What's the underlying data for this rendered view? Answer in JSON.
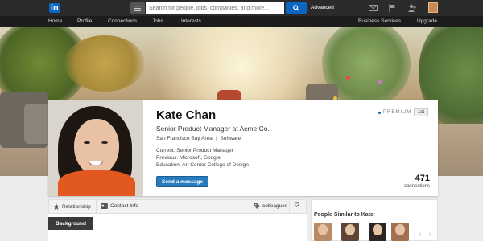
{
  "topbar": {
    "logo_text": "in",
    "search_placeholder": "Search for people, jobs, companies, and more...",
    "advanced_label": "Advanced",
    "icons": [
      "list-icon",
      "search-icon",
      "mail-icon",
      "flag-icon",
      "add-connection-icon",
      "profile-avatar"
    ]
  },
  "nav": {
    "items": [
      "Home",
      "Profile",
      "Connections",
      "Jobs",
      "Interests",
      "Business Services",
      "Upgrade"
    ]
  },
  "profile": {
    "name": "Kate Chan",
    "headline": "Senior Product Manager at Acme Co.",
    "location": "San Francisco Bay Area",
    "industry": "Software",
    "current": "Current: Senior Product Manager",
    "previous": "Previous: Microsoft, Google",
    "education": "Education: Art Center College of Design",
    "premium_label": "PREMIUM",
    "degree": "1st",
    "send_button": "Send a message",
    "connections_count": "471",
    "connections_label": "connections"
  },
  "tabs": {
    "relationship": "Relationship",
    "contact_info": "Contact Info",
    "tag": "colleagues"
  },
  "background_label": "Background",
  "similar": {
    "title": "People Similar to Kate"
  },
  "colors": {
    "topbar": "#2b2b2b",
    "navbar": "#1c1c1c",
    "accent": "#0a66c2",
    "send_button": "#287bbc"
  }
}
